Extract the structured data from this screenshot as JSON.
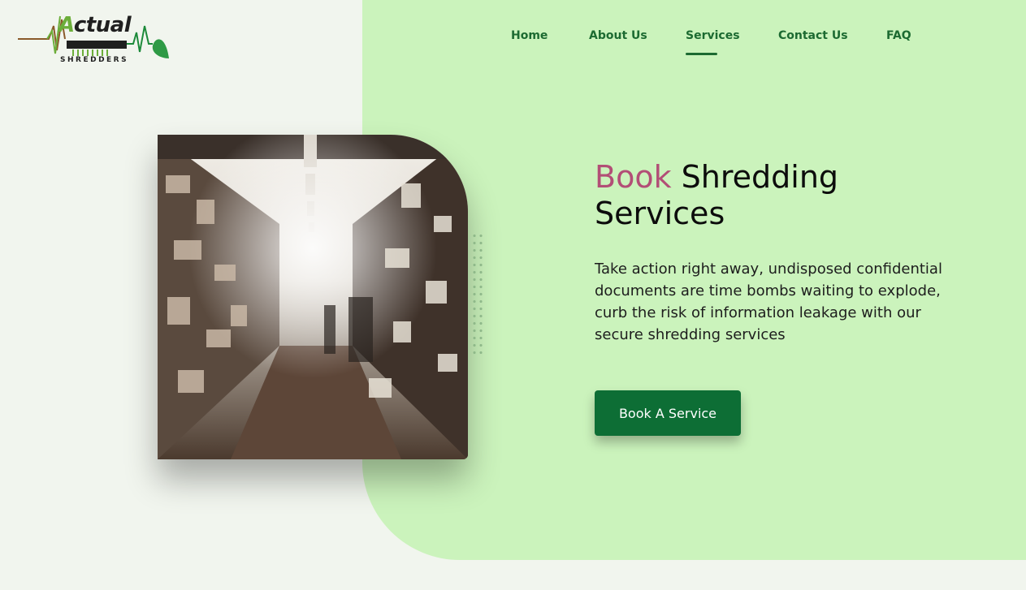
{
  "brand": {
    "logo_word_first": "A",
    "logo_word_rest": "ctual",
    "logo_sub": "SHREDDERS"
  },
  "nav": {
    "items": [
      {
        "label": "Home"
      },
      {
        "label": "About Us"
      },
      {
        "label": "Services",
        "active": true
      },
      {
        "label": "Contact Us"
      },
      {
        "label": "FAQ"
      }
    ]
  },
  "hero": {
    "title_accent": "Book",
    "title_rest": "Shredding Services",
    "description": "Take action right away, undisposed confidential documents are time bombs waiting to explode, curb the risk of information leakage with our secure shredding services",
    "cta_label": "Book A Service",
    "image_icon": "warehouse-aisle-photo"
  },
  "colors": {
    "panel": "#cbf3bc",
    "nav_text": "#1c6a31",
    "accent": "#b24e76",
    "button": "#0d6e35"
  }
}
